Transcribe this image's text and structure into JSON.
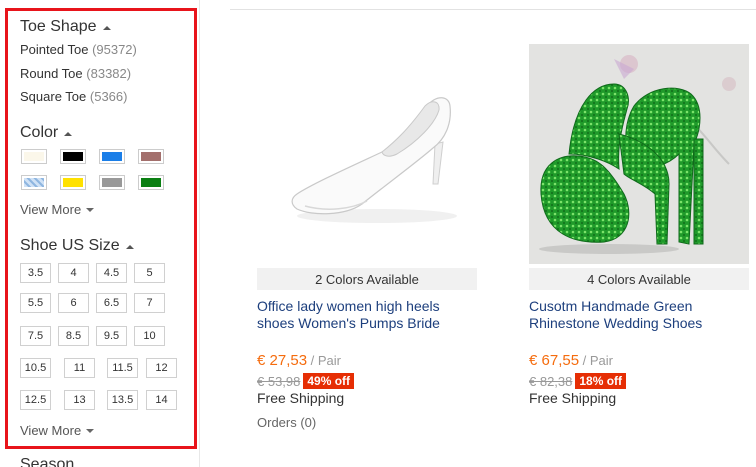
{
  "sidebar": {
    "toe_shape": {
      "title": "Toe Shape",
      "items": [
        {
          "label": "Pointed Toe",
          "count": "(95372)"
        },
        {
          "label": "Round Toe",
          "count": "(83382)"
        },
        {
          "label": "Square Toe",
          "count": "(5366)"
        }
      ]
    },
    "color": {
      "title": "Color",
      "swatches": [
        "#fbf7ea",
        "#000000",
        "#1a7ee8",
        "#a36f6c",
        "#cfe1f5",
        "#ffe100",
        "#999999",
        "#0a7f12"
      ],
      "view_more": "View More"
    },
    "shoe_size": {
      "title": "Shoe US Size",
      "sizes": [
        "3.5",
        "4",
        "4.5",
        "5",
        "5.5",
        "6",
        "6.5",
        "7",
        "7.5",
        "8.5",
        "9.5",
        "10",
        "10.5",
        "11",
        "11.5",
        "12",
        "12.5",
        "13",
        "13.5",
        "14"
      ],
      "view_more": "View More"
    },
    "season": {
      "title": "Season"
    }
  },
  "products": [
    {
      "colors_available": "2 Colors Available",
      "title": "Office lady women high heels shoes Women's Pumps Bride",
      "price": "€ 27,53",
      "unit": " / Pair",
      "old_price": "€ 53,98",
      "discount": "49% off",
      "shipping": "Free Shipping",
      "orders": "Orders (0)"
    },
    {
      "colors_available": "4 Colors Available",
      "title": "Cusotm Handmade Green Rhinestone Wedding Shoes",
      "price": "€ 67,55",
      "unit": " / Pair",
      "old_price": "€ 82,38",
      "discount": "18% off",
      "shipping": "Free Shipping"
    }
  ],
  "colors": {
    "highlight": "#e8141b",
    "price": "#f56c0e",
    "link": "#1d3f7d",
    "discount_bg": "#e62e04"
  }
}
